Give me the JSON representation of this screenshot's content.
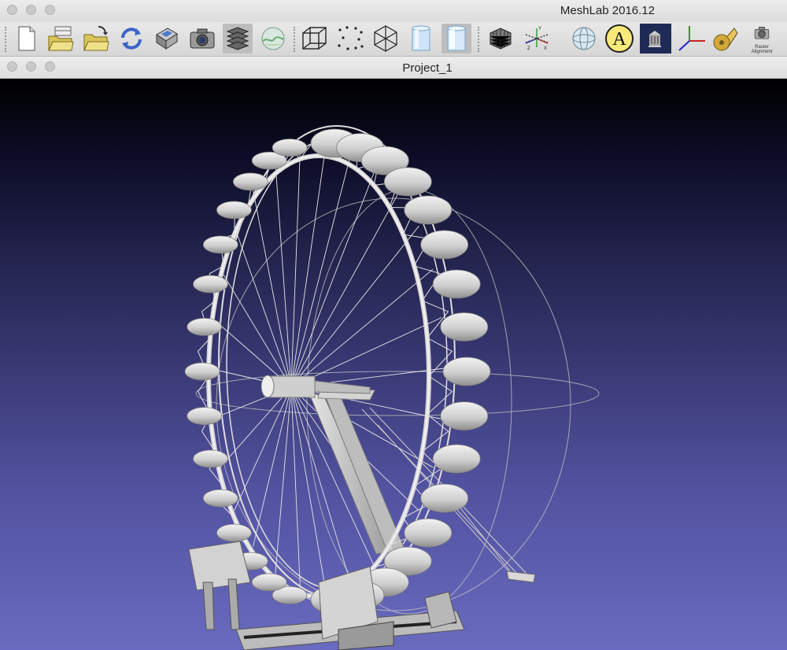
{
  "app": {
    "title": "MeshLab 2016.12"
  },
  "document": {
    "title": "Project_1"
  },
  "toolbar": {
    "raster_label_line1": "Raster",
    "raster_label_line2": "Alignment",
    "annotation_letter": "A",
    "icons": [
      "new-project-icon",
      "open-project-icon",
      "import-mesh-icon",
      "reload-icon",
      "export-mesh-icon",
      "snapshot-icon",
      "layers-icon",
      "render-settings-icon",
      "bounding-box-icon",
      "points-icon",
      "wireframe-icon",
      "flat-lines-icon",
      "smooth-icon",
      "hidden-lines-icon",
      "trackball-icon",
      "sphere-icon",
      "annotation-icon",
      "background-icon",
      "axis-icon",
      "measure-icon",
      "raster-alignment-icon"
    ]
  },
  "viewport": {
    "model": "ferris-wheel-mesh"
  }
}
